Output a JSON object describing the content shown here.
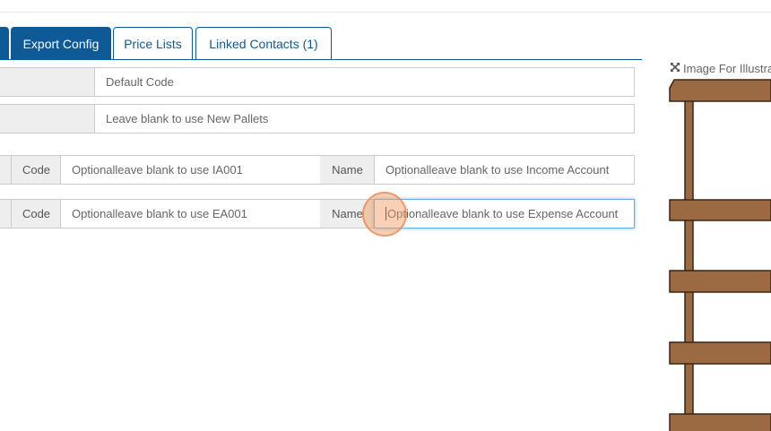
{
  "tabs": [
    {
      "label": "Export Config",
      "active": true
    },
    {
      "label": "Price Lists",
      "active": false
    },
    {
      "label": "Linked Contacts (1)",
      "active": false
    }
  ],
  "fields": {
    "default_code": {
      "placeholder": "Default Code"
    },
    "pallets": {
      "placeholder": "Leave blank to use New Pallets"
    },
    "income": {
      "code_label": "Code",
      "code_placeholder": "Optionalleave blank to use IA001",
      "name_label": "Name",
      "name_placeholder": "Optionalleave blank to use Income Account"
    },
    "expense": {
      "code_label": "Code",
      "code_placeholder": "Optionalleave blank to use EA001",
      "name_label": "Name",
      "name_placeholder": "Optionalleave blank to use Expense Account"
    }
  },
  "illustration": {
    "label": "Image For Illustra",
    "icon": "expand-icon",
    "wood_color": "#9b6a43",
    "wood_stroke": "#3a2412"
  },
  "colors": {
    "accent": "#0e5a97",
    "focus": "#66afe9"
  }
}
